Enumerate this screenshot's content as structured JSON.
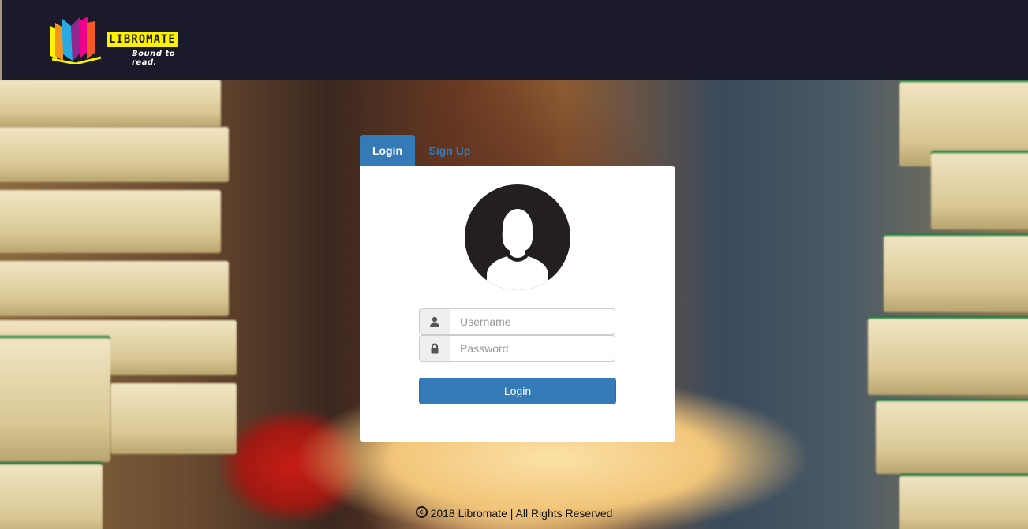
{
  "brand": {
    "name": "LIBROMATE",
    "tagline": "Bound to read.",
    "colors": {
      "yellow": "#fff200",
      "header": "#1a1a2b"
    }
  },
  "tabs": [
    {
      "label": "Login",
      "active": true
    },
    {
      "label": "Sign Up",
      "active": false
    }
  ],
  "login_form": {
    "avatar_icon": "user-silhouette-icon",
    "username": {
      "icon": "user-icon",
      "placeholder": "Username",
      "value": ""
    },
    "password": {
      "icon": "lock-icon",
      "placeholder": "Password",
      "value": ""
    },
    "submit_label": "Login"
  },
  "footer": {
    "icon": "copyright-icon",
    "text": "2018 Libromate | All Rights Reserved"
  },
  "accent_color": "#337ab7"
}
